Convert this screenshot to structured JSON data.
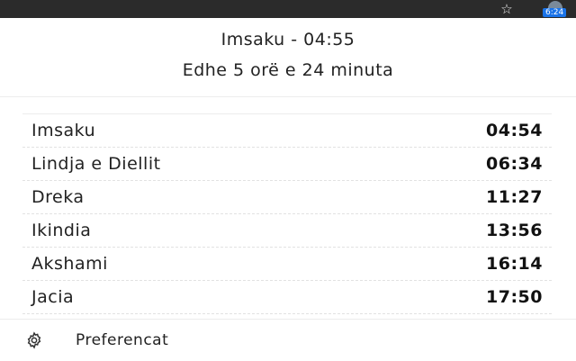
{
  "browser": {
    "star_icon": "star-icon",
    "extension_badge": "6:24",
    "extension_icon": "extension-icon"
  },
  "header": {
    "next_prayer": "Imsaku - 04:55",
    "countdown": "Edhe 5 orë e 24 minuta"
  },
  "prayers": [
    {
      "name": "Imsaku",
      "time": "04:54"
    },
    {
      "name": "Lindja e Diellit",
      "time": "06:34"
    },
    {
      "name": "Dreka",
      "time": "11:27"
    },
    {
      "name": "Ikindia",
      "time": "13:56"
    },
    {
      "name": "Akshami",
      "time": "16:14"
    },
    {
      "name": "Jacia",
      "time": "17:50"
    }
  ],
  "footer": {
    "gear_icon": "gear-icon",
    "preferences_label": "Preferencat"
  },
  "colors": {
    "badge": "#1a73e8",
    "browser_bar": "#2b2b2b",
    "text": "#222222"
  }
}
